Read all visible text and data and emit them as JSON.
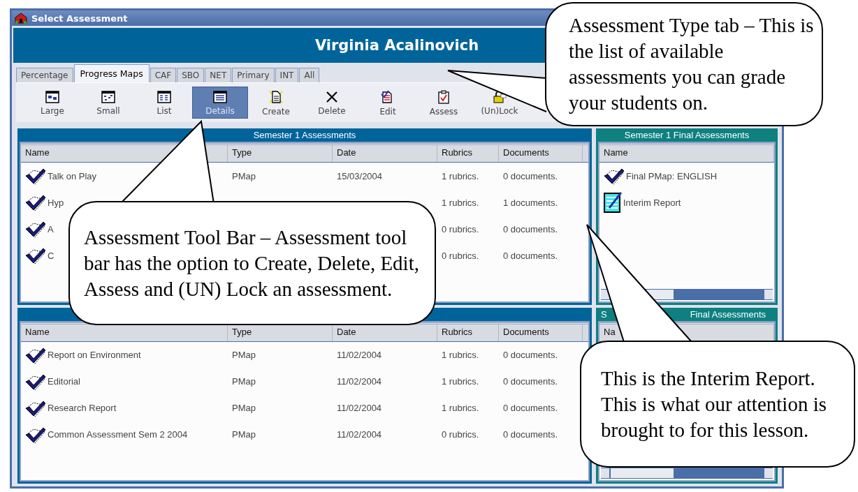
{
  "window": {
    "title": "Select Assessment"
  },
  "banner": {
    "name": "Virginia Acalinovich"
  },
  "tabs": [
    {
      "label": "Percentage",
      "selected": false
    },
    {
      "label": "Progress Maps",
      "selected": true
    },
    {
      "label": "CAF",
      "selected": false
    },
    {
      "label": "SBO",
      "selected": false
    },
    {
      "label": "NET",
      "selected": false
    },
    {
      "label": "Primary",
      "selected": false
    },
    {
      "label": "INT",
      "selected": false
    },
    {
      "label": "All",
      "selected": false
    }
  ],
  "toolbar": [
    {
      "label": "Large",
      "selected": false
    },
    {
      "label": "Small",
      "selected": false
    },
    {
      "label": "List",
      "selected": false
    },
    {
      "label": "Details",
      "selected": true
    },
    {
      "label": "Create",
      "selected": false
    },
    {
      "label": "Delete",
      "selected": false
    },
    {
      "label": "Edit",
      "selected": false
    },
    {
      "label": "Assess",
      "selected": false
    },
    {
      "label": "(Un)Lock",
      "selected": false
    }
  ],
  "semester_1": {
    "title": "Semester 1 Assessments",
    "columns": [
      "Name",
      "Type",
      "Date",
      "Rubrics",
      "Documents"
    ],
    "rows": [
      {
        "name": "Talk on Play",
        "type": "PMap",
        "date": "15/03/2004",
        "rubrics": "1 rubrics.",
        "documents": "0 documents."
      },
      {
        "name": "Hyp",
        "rubrics": "1 rubrics.",
        "documents": "1 documents."
      },
      {
        "name": "A",
        "rubrics": "0 rubrics.",
        "documents": "0 documents."
      },
      {
        "name": "C",
        "rubrics": "0 rubrics.",
        "documents": "0 documents."
      }
    ]
  },
  "semester_2": {
    "columns": [
      "Name",
      "Type",
      "Date",
      "Rubrics",
      "Documents"
    ],
    "rows": [
      {
        "name": "Report on Environment",
        "type": "PMap",
        "date": "11/02/2004",
        "rubrics": "1 rubrics.",
        "documents": "0 documents."
      },
      {
        "name": "Editorial",
        "type": "PMap",
        "date": "11/02/2004",
        "rubrics": "1 rubrics.",
        "documents": "0 documents."
      },
      {
        "name": "Research Report",
        "type": "PMap",
        "date": "11/02/2004",
        "rubrics": "1 rubrics.",
        "documents": "0 documents."
      },
      {
        "name": "Common Assessment Sem 2 2004",
        "type": "PMap",
        "date": "11/02/2004",
        "rubrics": "0 rubrics.",
        "documents": "0 documents."
      }
    ]
  },
  "semester_1_final": {
    "title": "Semester 1 Final Assessments",
    "columns": [
      "Name"
    ],
    "items": [
      {
        "kind": "assessment",
        "name": "Final PMap: ENGLISH"
      },
      {
        "kind": "report",
        "name": "Interim Report"
      }
    ]
  },
  "final_2": {
    "title_parts": [
      "S",
      "Final Assessments"
    ],
    "columns": [
      "Na"
    ]
  },
  "callouts": [
    {
      "text": "Assessment Type tab – This is the list of available assessments you can grade your students on."
    },
    {
      "text": "Assessment Tool Bar – Assessment tool bar has the option to Create, Delete, Edit, Assess and (UN) Lock an assessment."
    },
    {
      "text": "This is the Interim Report. This is what our attention is brought to for this lesson."
    }
  ]
}
